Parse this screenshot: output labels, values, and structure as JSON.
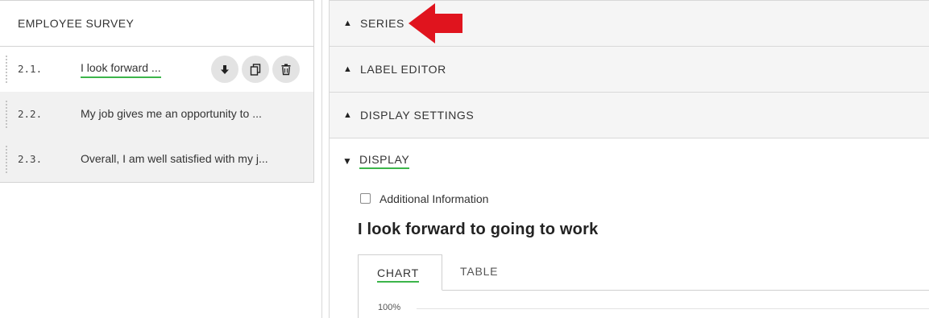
{
  "survey": {
    "title": "EMPLOYEE SURVEY",
    "questions": [
      {
        "number": "2.1.",
        "text": "I look forward ...",
        "active": true
      },
      {
        "number": "2.2.",
        "text": "My job gives me an opportunity to ...",
        "active": false
      },
      {
        "number": "2.3.",
        "text": "Overall, I am well satisfied with my j...",
        "active": false
      }
    ],
    "actions": {
      "move_icon": "arrow-down-icon",
      "copy_icon": "copy-icon",
      "delete_icon": "trash-icon"
    }
  },
  "panel": {
    "sections": [
      {
        "label": "SERIES",
        "collapsed_icon": "▲"
      },
      {
        "label": "LABEL EDITOR",
        "collapsed_icon": "▲"
      },
      {
        "label": "DISPLAY SETTINGS",
        "collapsed_icon": "▲"
      }
    ],
    "display": {
      "label": "DISPLAY",
      "expanded_icon": "▼",
      "additional_info_label": "Additional Information",
      "additional_info_checked": false,
      "question_title": "I look forward to going to work",
      "tabs": [
        {
          "label": "CHART",
          "active": true
        },
        {
          "label": "TABLE",
          "active": false
        }
      ],
      "y_tick_top": "100%"
    }
  },
  "colors": {
    "accent_green": "#3cb54a",
    "annotation_red": "#e0141e"
  }
}
